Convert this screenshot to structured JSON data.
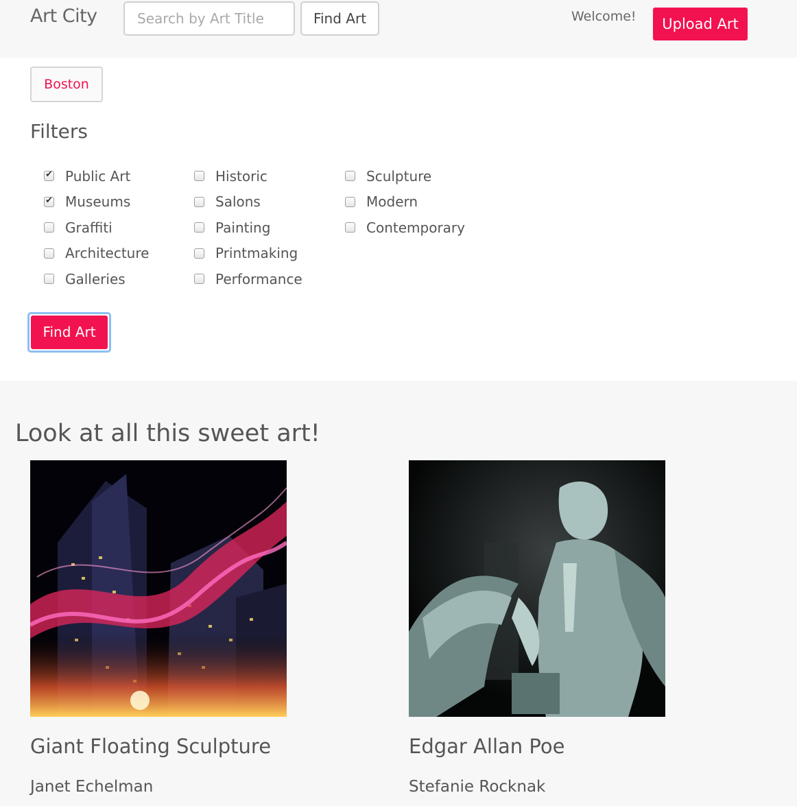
{
  "navbar": {
    "brand": "Art City",
    "search_placeholder": "Search by Art Title",
    "find_label": "Find Art",
    "welcome": "Welcome!",
    "upload_label": "Upload Art"
  },
  "city": "Boston",
  "filters": {
    "title": "Filters",
    "columns": [
      [
        {
          "label": "Public Art",
          "checked": true
        },
        {
          "label": "Museums",
          "checked": true
        },
        {
          "label": "Graffiti",
          "checked": false
        },
        {
          "label": "Architecture",
          "checked": false
        },
        {
          "label": "Galleries",
          "checked": false
        }
      ],
      [
        {
          "label": "Historic",
          "checked": false
        },
        {
          "label": "Salons",
          "checked": false
        },
        {
          "label": "Painting",
          "checked": false
        },
        {
          "label": "Printmaking",
          "checked": false
        },
        {
          "label": "Performance",
          "checked": false
        }
      ],
      [
        {
          "label": "Sculpture",
          "checked": false
        },
        {
          "label": "Modern",
          "checked": false
        },
        {
          "label": "Contemporary",
          "checked": false
        }
      ]
    ],
    "submit_label": "Find Art"
  },
  "gallery": {
    "title": "Look at all this sweet art!",
    "items": [
      {
        "title": "Giant Floating Sculpture",
        "artist": "Janet Echelman"
      },
      {
        "title": "Edgar Allan Poe",
        "artist": "Stefanie Rocknak"
      }
    ]
  },
  "colors": {
    "accent": "#f2124f",
    "focus_ring": "#8dbef3",
    "nav_bg": "#f7f7f7"
  }
}
